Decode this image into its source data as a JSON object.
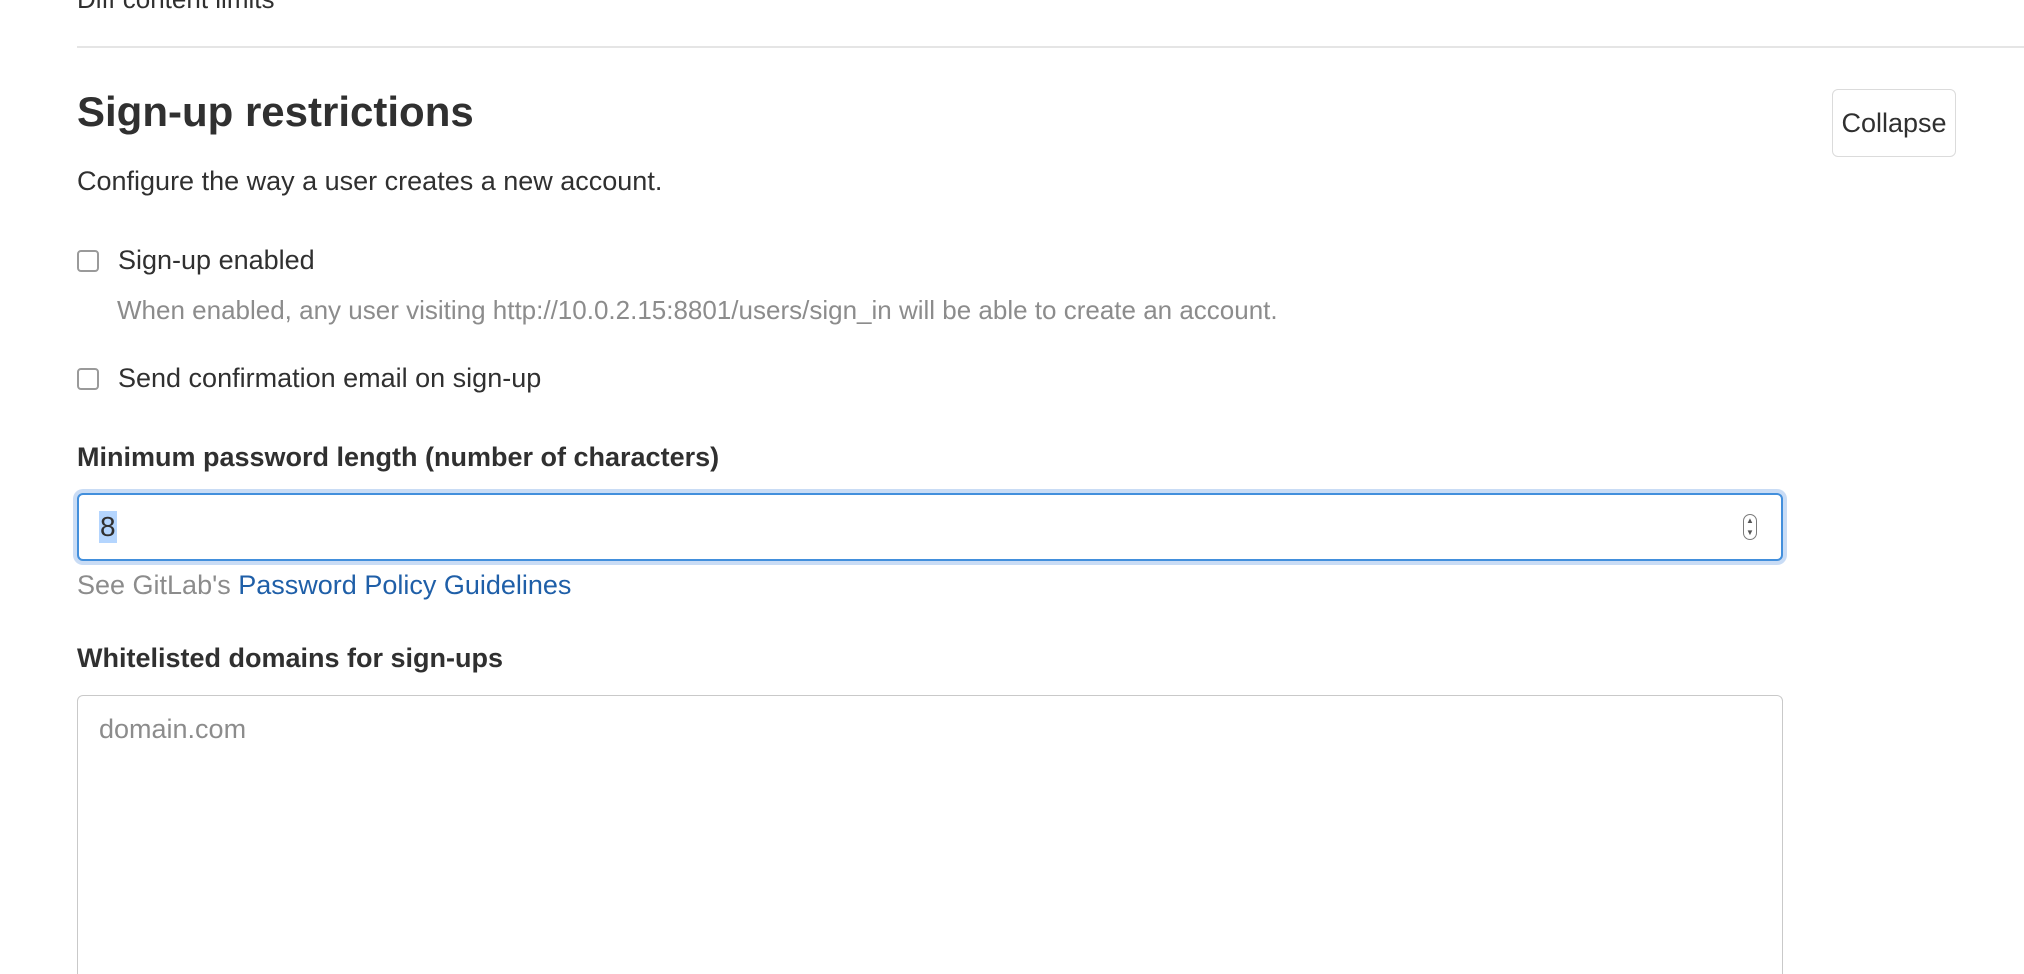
{
  "previous_section": {
    "label": "Diff content limits"
  },
  "section": {
    "title": "Sign-up restrictions",
    "description": "Configure the way a user creates a new account.",
    "collapse_label": "Collapse"
  },
  "signup_enabled": {
    "label": "Sign-up enabled",
    "checked": false,
    "help": "When enabled, any user visiting http://10.0.2.15:8801/users/sign_in will be able to create an account."
  },
  "send_confirmation": {
    "label": "Send confirmation email on sign-up",
    "checked": false
  },
  "min_password": {
    "label": "Minimum password length (number of characters)",
    "value": "8",
    "help_prefix": "See GitLab's",
    "help_link": "Password Policy Guidelines"
  },
  "whitelisted_domains": {
    "label": "Whitelisted domains for sign-ups",
    "placeholder": "domain.com"
  },
  "icons": {
    "spinner_up": "chevron-up-icon",
    "spinner_down": "chevron-down-icon"
  },
  "colors": {
    "link": "#1f5fa8",
    "focus_border": "#428fdc",
    "muted_text": "#8c8c8c"
  }
}
